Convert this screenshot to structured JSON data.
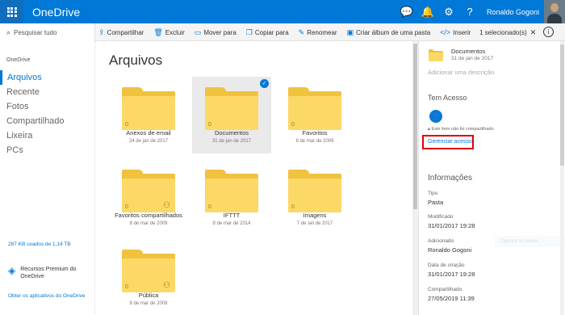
{
  "header": {
    "brand": "OneDrive",
    "user": "Ronaldo Gogoni"
  },
  "commands": {
    "search_placeholder": "Pesquisar tudo",
    "items": [
      "Compartilhar",
      "Excluir",
      "Mover para",
      "Copiar para",
      "Renomear",
      "Criar álbum de uma pasta",
      "Inserir"
    ],
    "selected": "1 selecionado(s)"
  },
  "sidebar": {
    "section": "OneDrive",
    "items": [
      "Arquivos",
      "Recente",
      "Fotos",
      "Compartilhado",
      "Lixeira",
      "PCs"
    ],
    "storage": "287 KB usados de 1,14 TB",
    "premium": "Recursos Premium do OneDrive",
    "apps": "Obter os aplicativos do OneDrive"
  },
  "main": {
    "title": "Arquivos",
    "folders": [
      {
        "name": "Anexos de email",
        "date": "24 de jan de 2017",
        "count": "0"
      },
      {
        "name": "Documentos",
        "date": "31 de jan de 2017",
        "count": "0"
      },
      {
        "name": "Favoritos",
        "date": "8 de mar de 2009",
        "count": "0"
      },
      {
        "name": "Favoritos compartilhados",
        "date": "8 de mar de 2009",
        "count": "0"
      },
      {
        "name": "IFTTT",
        "date": "8 de mar de 2014",
        "count": "0"
      },
      {
        "name": "Imagens",
        "date": "7 de set de 2017",
        "count": "0"
      },
      {
        "name": "Pública",
        "date": "8 de mar de 2009",
        "count": "0"
      }
    ]
  },
  "details": {
    "title": "Documentos",
    "date": "31 de jan de 2017",
    "add_description": "Adicionar uma descrição",
    "access_heading": "Tem Acesso",
    "not_shared": "Este item não foi compartilhado",
    "manage": "Gerenciar acesso",
    "info_heading": "Informações",
    "type_label": "Tipo",
    "type_value": "Pasta",
    "modified_label": "Modificado",
    "modified_value": "31/01/2017 19:28",
    "added_label": "Adicionado",
    "added_value": "Ronaldo Gogoni",
    "created_label": "Data de criação",
    "created_value": "31/01/2017 19:28",
    "shared_label": "Compartilhado",
    "shared_value": "27/05/2019 11:39",
    "faint_text": "Captura de janela"
  }
}
